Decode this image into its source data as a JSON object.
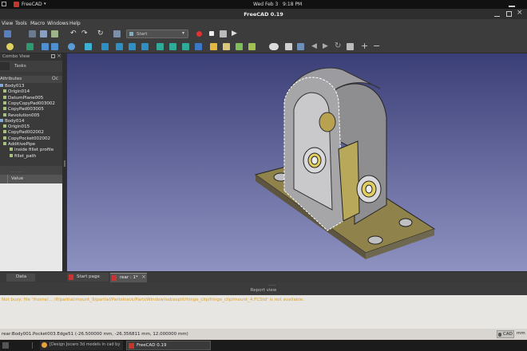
{
  "system": {
    "activities_icon": "app-grid-icon",
    "app_menu": "FreeCAD",
    "clock": "Wed Feb 3   9:18 PM"
  },
  "window": {
    "title": "FreeCAD 0.19"
  },
  "menubar": {
    "items": [
      "View",
      "Tools",
      "Macro",
      "Windows",
      "Help"
    ]
  },
  "toolbar": {
    "macro_select": "Start"
  },
  "combo_view": {
    "title": "Combo View",
    "tab_label": "Tasks",
    "section_label": "Attributes",
    "tree": [
      {
        "label": "Body013",
        "indent": 0
      },
      {
        "label": "Origin014",
        "indent": 1
      },
      {
        "label": "DatumPlane005",
        "indent": 1
      },
      {
        "label": "CopyCopyPad003002",
        "indent": 1
      },
      {
        "label": "CopyPad003005",
        "indent": 1
      },
      {
        "label": "Revolution005",
        "indent": 1
      },
      {
        "label": "Body014",
        "indent": 0
      },
      {
        "label": "Origin015",
        "indent": 1
      },
      {
        "label": "CopyPad002002",
        "indent": 1
      },
      {
        "label": "CopyPocket002002",
        "indent": 1
      },
      {
        "label": "AdditivePipe",
        "indent": 1
      },
      {
        "label": "inside fillet profile",
        "indent": 2
      },
      {
        "label": "fillet_path",
        "indent": 2
      }
    ],
    "property_header": "Value",
    "data_tab": "Data"
  },
  "doc_tabs": [
    {
      "label": "Start page",
      "active": false
    },
    {
      "label": "rear : 1*",
      "active": true
    }
  ],
  "report": {
    "title": "Report view",
    "message": "Not busy: file '/home/... /lf/partial/mount_9/partial/Partstrack/PartsWindow/asbasplit/hinge_clip/hinge_clip/mount_4.FCStd' is not available.",
    "message_color": "#e0a020"
  },
  "status_bar": {
    "text": "rear:Body001.Pocket003.Edge51 (-26.500000 mm, -26.356811 mm, 12.000000 mm)",
    "nav_style": "CAD",
    "unit": "mm"
  },
  "taskbar": {
    "items": [
      {
        "label": "[Design Jocaro 3d models in cad by G...",
        "icon": "browser-icon"
      },
      {
        "label": "FreeCAD 0.19",
        "icon": "freecad-icon"
      }
    ]
  },
  "colors": {
    "face_yellow": "#b7a85a",
    "body_gray": "#a9a9ab",
    "selected_edge": "#ffffff",
    "viewport_top": "#3b3f77",
    "viewport_bottom": "#8e92c0"
  }
}
